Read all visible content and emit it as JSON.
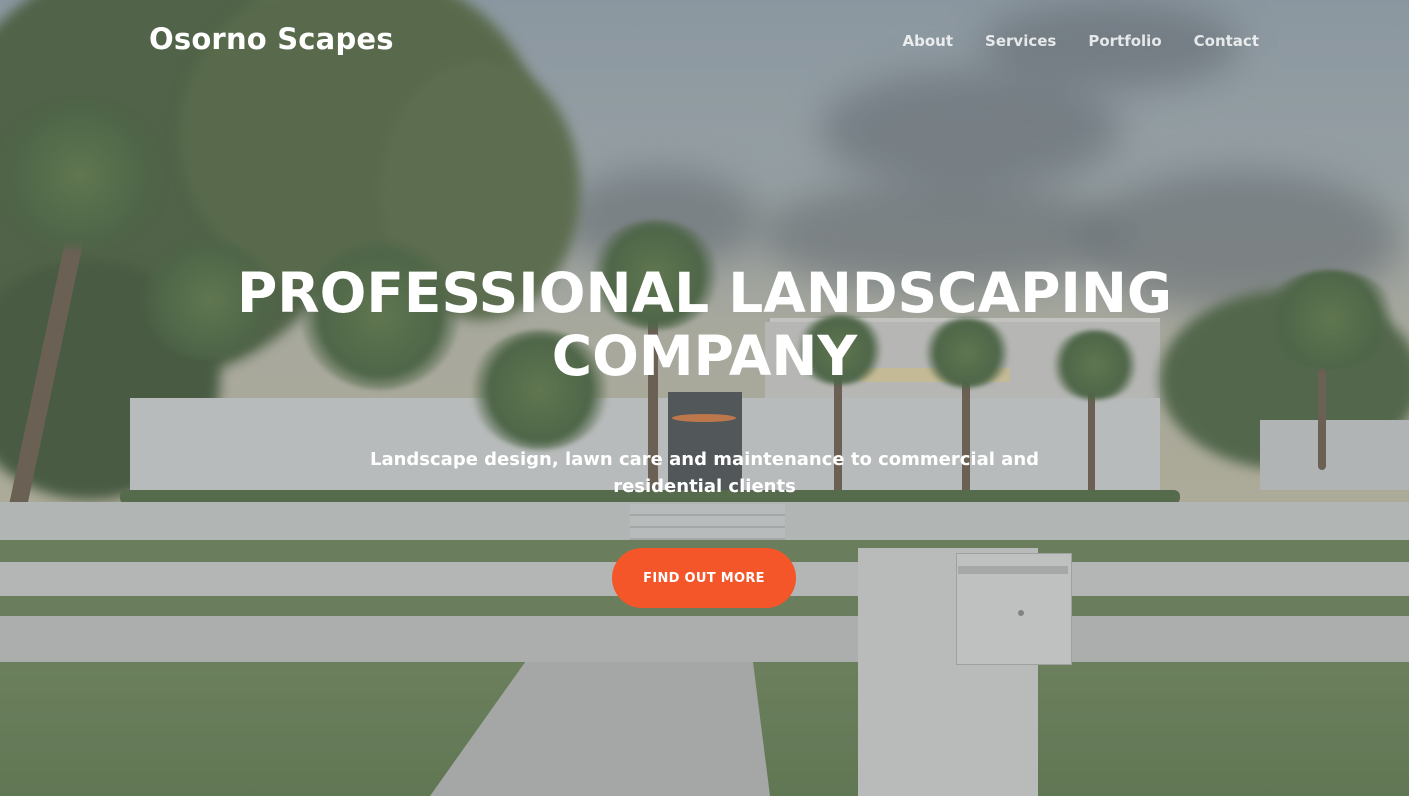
{
  "brand": {
    "name": "Osorno Scapes"
  },
  "nav": {
    "items": [
      {
        "label": "About"
      },
      {
        "label": "Services"
      },
      {
        "label": "Portfolio"
      },
      {
        "label": "Contact"
      }
    ]
  },
  "hero": {
    "title_line1": "PROFESSIONAL LANDSCAPING",
    "title_line2": "COMPANY",
    "subtitle": "Landscape design, lawn care and maintenance to commercial and residential clients",
    "cta_label": "FIND OUT MORE",
    "background_image": "modern white house with palm trees, lawn and mailbox"
  },
  "colors": {
    "accent": "#f4562a",
    "text": "#ffffff"
  }
}
